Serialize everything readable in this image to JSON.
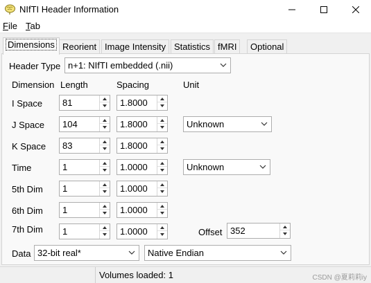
{
  "window": {
    "title": "NIfTI Header Information",
    "icon": "brain-icon",
    "controls": [
      "minimize-icon",
      "maximize-icon",
      "close-icon"
    ]
  },
  "menu": {
    "file": {
      "underlined": "F",
      "rest": "ile"
    },
    "tab": {
      "underlined": "T",
      "rest": "ab"
    }
  },
  "tabs": [
    {
      "label": "Dimensions",
      "active": true
    },
    {
      "label": "Reorient"
    },
    {
      "label": "Image Intensity"
    },
    {
      "label": "Statistics"
    },
    {
      "label": "fMRI"
    },
    {
      "label": "Optional"
    }
  ],
  "header_type": {
    "label": "Header Type",
    "value": "n+1: NIfTI   embedded (.nii)"
  },
  "columns": {
    "dimension": "Dimension",
    "length": "Length",
    "spacing": "Spacing",
    "unit": "Unit"
  },
  "rows": [
    {
      "name": "I Space",
      "length": "81",
      "spacing": "1.8000"
    },
    {
      "name": "J Space",
      "length": "104",
      "spacing": "1.8000",
      "unit": "Unknown"
    },
    {
      "name": "K Space",
      "length": "83",
      "spacing": "1.8000"
    },
    {
      "name": "Time",
      "length": "1",
      "spacing": "1.0000",
      "unit": "Unknown"
    },
    {
      "name": "5th Dim",
      "length": "1",
      "spacing": "1.0000"
    },
    {
      "name": "6th Dim",
      "length": "1",
      "spacing": "1.0000"
    },
    {
      "name": "7th Dim",
      "length": "1",
      "spacing": "1.0000"
    }
  ],
  "offset": {
    "label": "Offset",
    "value": "352"
  },
  "data": {
    "label": "Data",
    "type": "32-bit real*",
    "endian": "Native Endian"
  },
  "status": {
    "text": "Volumes loaded: 1",
    "watermark": "CSDN @夏莉莉iy"
  },
  "colors": {
    "panel": "#f9f9f9",
    "window": "#f0f0f0",
    "border": "#adadad"
  }
}
